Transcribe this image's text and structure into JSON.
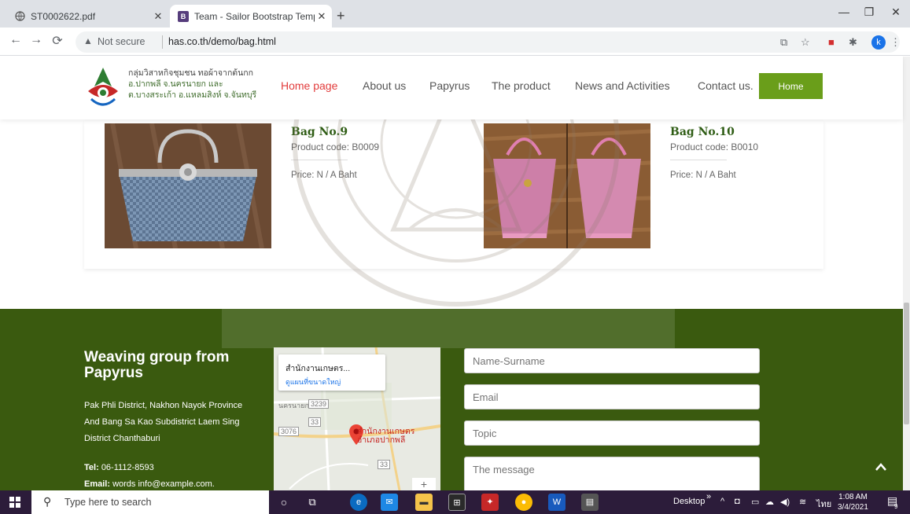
{
  "browser": {
    "tabs": [
      {
        "title": "ST0002622.pdf",
        "icon": "globe-icon",
        "active": false
      },
      {
        "title": "Team - Sailor Bootstrap Template",
        "icon": "bootstrap-icon",
        "active": true
      }
    ],
    "new_tab": "+",
    "security_label": "Not secure",
    "url": "has.co.th/demo/bag.html",
    "profile_initial": "k"
  },
  "site": {
    "logo_lines": [
      "กลุ่มวิสาหกิจชุมชน ทอผ้าจากต้นกก",
      "อ.ปากพลี จ.นครนายก และ",
      "ต.บางสระเก้า อ.แหลมสิงห์ จ.จันทบุรี"
    ],
    "nav": [
      "Home page",
      "About us",
      "Papyrus",
      "The product",
      "News and Activities",
      "Contact us."
    ],
    "home_button": "Home"
  },
  "products": [
    {
      "title": "Bag No.9",
      "code": "Product code: B0009",
      "price": "Price: N / A Baht"
    },
    {
      "title": "Bag No.10",
      "code": "Product code: B0010",
      "price": "Price: N / A Baht"
    }
  ],
  "footer": {
    "title": "Weaving group from Papyrus",
    "address": "Pak Phli District, Nakhon Nayok Province And Bang Sa Kao Subdistrict Laem Sing District Chanthaburi",
    "tel_label": "Tel:",
    "tel": "06-1112-8593",
    "email_label": "Email:",
    "email": "words info@example.com.",
    "map": {
      "place_name": "สำนักงานเกษตร...",
      "view_larger": "ดูแผนที่ขนาดใหญ่",
      "pin_label_1": "สำนักงานเกษตร",
      "pin_label_2": "อำเภอปากพลี",
      "road_1": "3239",
      "road_2": "33",
      "road_3": "3076",
      "road_4": "33",
      "town": "นครนายก"
    },
    "form": {
      "name_placeholder": "Name-Surname",
      "email_placeholder": "Email",
      "topic_placeholder": "Topic",
      "message_placeholder": "The message"
    }
  },
  "taskbar": {
    "search_placeholder": "Type here to search",
    "desktop_label": "Desktop",
    "lang": "ไทย",
    "time": "1:08 AM",
    "date": "3/4/2021",
    "notification_count": "9"
  }
}
